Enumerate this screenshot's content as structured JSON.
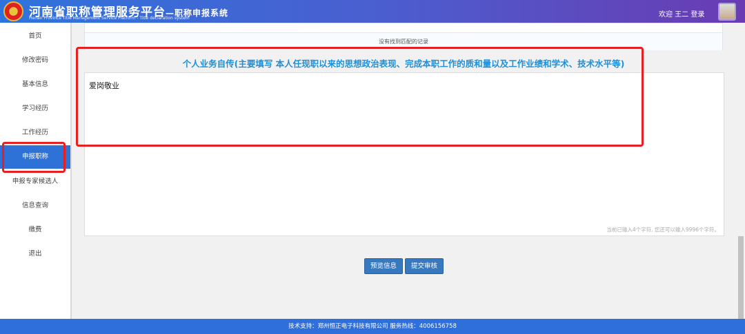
{
  "header": {
    "title": "河南省职称管理服务平台",
    "title_suffix": "—职称申报系统",
    "subtitle": "Henan Province Title Management Service Platform - Title declaration system",
    "welcome": "欢迎 王二 登录"
  },
  "sidebar": {
    "items": [
      {
        "label": "首页"
      },
      {
        "label": "修改密码"
      },
      {
        "label": "基本信息"
      },
      {
        "label": "学习经历"
      },
      {
        "label": "工作经历"
      },
      {
        "label": "申报职称",
        "active": true
      },
      {
        "label": "申报专家候选人"
      },
      {
        "label": "信息查询"
      },
      {
        "label": "缴费"
      },
      {
        "label": "退出"
      }
    ]
  },
  "table": {
    "empty_text": "没有找到匹配的记录"
  },
  "section": {
    "heading": "个人业务自传(主要填写 本人任现职以来的思想政治表现、完成本职工作的质和量以及工作业绩和学术、技术水平等)",
    "text": "爱岗敬业",
    "counter": "当前已输入4个字符, 您还可以输入9996个字符。"
  },
  "buttons": {
    "preview": "预览信息",
    "submit": "提交审核"
  },
  "footer": {
    "text": "技术支持：郑州恒正电子科技有限公司 服务热线：4006156758"
  },
  "colors": {
    "header_start": "#2f73dc",
    "header_end": "#6a3bb2",
    "active": "#2e72d8",
    "highlight": "#e62020",
    "heading": "#1e8fd8"
  }
}
